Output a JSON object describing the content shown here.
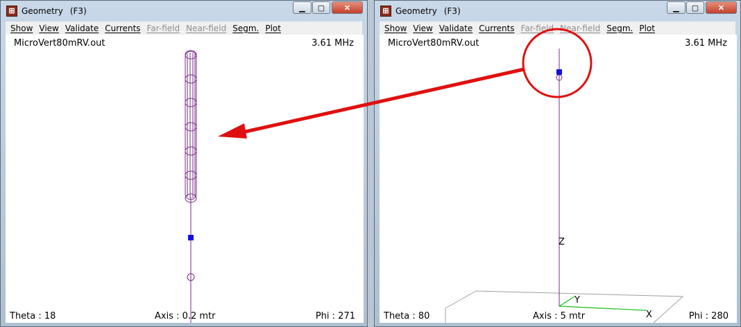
{
  "windows": [
    {
      "title": "Geometry",
      "shortcut": "(F3)",
      "menu": [
        "Show",
        "View",
        "Validate",
        "Currents",
        "Far-field",
        "Near-field",
        "Segm.",
        "Plot"
      ],
      "menu_disabled": [
        "Far-field",
        "Near-field"
      ],
      "file_name": "MicroVert80mRV.out",
      "frequency": "3.61 MHz",
      "theta": "Theta : 18",
      "axis": "Axis : 0.2 mtr",
      "phi": "Phi : 271"
    },
    {
      "title": "Geometry",
      "shortcut": "(F3)",
      "menu": [
        "Show",
        "View",
        "Validate",
        "Currents",
        "Far-field",
        "Near-field",
        "Segm.",
        "Plot"
      ],
      "menu_disabled": [
        "Far-field",
        "Near-field"
      ],
      "file_name": "MicroVert80mRV.out",
      "frequency": "3.61 MHz",
      "theta": "Theta : 80",
      "axis": "Axis : 5 mtr",
      "phi": "Phi : 280",
      "axis_labels": {
        "z": "Z",
        "y": "Y",
        "x": "X"
      }
    }
  ],
  "colors": {
    "antenna": "#7a2a8a",
    "feed": "#1010e0",
    "annotation": "#e01010",
    "axis_green": "#18c018"
  },
  "icons": {
    "app": "geometry-app-icon",
    "minimize": "minimize-icon",
    "maximize": "maximize-icon",
    "close": "close-icon"
  }
}
